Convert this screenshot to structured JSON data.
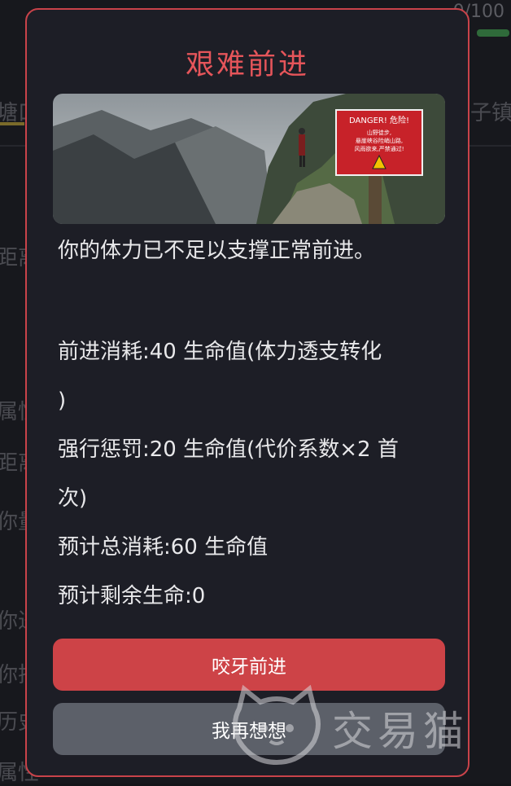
{
  "background": {
    "hp": "0/100",
    "fragments": [
      "塘口",
      "子镇",
      "距离",
      "属性",
      "距离",
      "你量",
      "你进",
      "你把",
      "历史",
      "属性"
    ]
  },
  "dialog": {
    "title": "艰难前进",
    "hero_sign": {
      "header": "DANGER! 危险!",
      "line1": "山野徒步,",
      "line2": "悬崖峡谷险峭山路,",
      "line3": "风雨欲来,严禁通过!"
    },
    "message": "你的体力已不足以支撑正常前进。",
    "cost_line": "前进消耗:40 生命值(体力透支转化",
    "cost_line_cont": ")",
    "penalty_line": "强行惩罚:20 生命值(代价系数×2 首",
    "penalty_line_cont": "次)",
    "total_line": "预计总消耗:60 生命值",
    "remaining_line": "预计剩余生命:0",
    "confirm_button": "咬牙前进",
    "cancel_button": "我再想想"
  },
  "watermark": {
    "text": "交易猫"
  },
  "colors": {
    "accent": "#e5555a",
    "border": "#c9434a",
    "primary_button": "#cd4347",
    "secondary_button": "#5c6069",
    "dialog_bg": "#1d1e26"
  }
}
